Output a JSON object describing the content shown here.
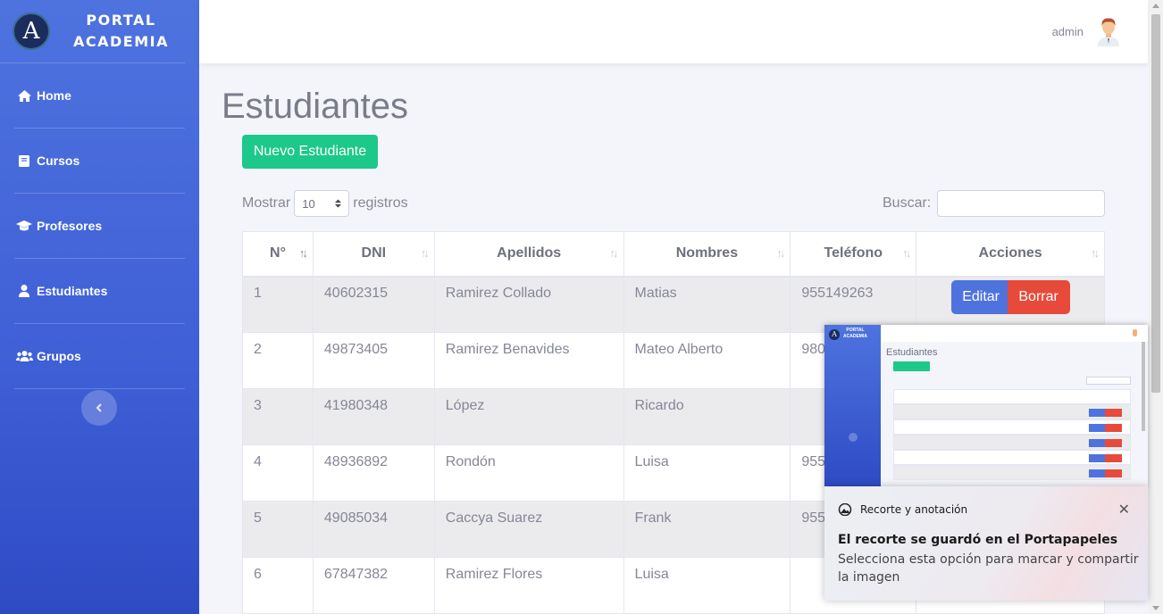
{
  "brand": {
    "logo_letter": "A",
    "line1": "PORTAL",
    "line2": "ACADEMIA"
  },
  "sidebar": {
    "items": [
      {
        "label": "Home",
        "icon": "home-icon"
      },
      {
        "label": "Cursos",
        "icon": "book-icon"
      },
      {
        "label": "Profesores",
        "icon": "graduation-cap-icon"
      },
      {
        "label": "Estudiantes",
        "icon": "user-icon"
      },
      {
        "label": "Grupos",
        "icon": "users-icon"
      }
    ],
    "toggle_icon": "chevron-left-icon"
  },
  "topbar": {
    "user_name": "admin"
  },
  "page": {
    "title": "Estudiantes",
    "new_button": "Nuevo Estudiante",
    "length_prefix": "Mostrar",
    "length_value": "10",
    "length_suffix": "registros",
    "search_label": "Buscar:",
    "search_value": ""
  },
  "table": {
    "headers": [
      "N°",
      "DNI",
      "Apellidos",
      "Nombres",
      "Teléfono",
      "Acciones"
    ],
    "edit_label": "Editar",
    "delete_label": "Borrar",
    "rows": [
      {
        "n": "1",
        "dni": "40602315",
        "apellidos": "Ramirez Collado",
        "nombres": "Matias",
        "telefono": "955149263"
      },
      {
        "n": "2",
        "dni": "49873405",
        "apellidos": "Ramirez Benavides",
        "nombres": "Mateo Alberto",
        "telefono": "980"
      },
      {
        "n": "3",
        "dni": "41980348",
        "apellidos": "López",
        "nombres": "Ricardo",
        "telefono": ""
      },
      {
        "n": "4",
        "dni": "48936892",
        "apellidos": "Rondón",
        "nombres": "Luisa",
        "telefono": "955"
      },
      {
        "n": "5",
        "dni": "49085034",
        "apellidos": "Caccya Suarez",
        "nombres": "Frank",
        "telefono": "955"
      },
      {
        "n": "6",
        "dni": "67847382",
        "apellidos": "Ramirez Flores",
        "nombres": "Luisa",
        "telefono": ""
      }
    ]
  },
  "toast": {
    "app_name": "Recorte y anotación",
    "heading": "El recorte se guardó en el Portapapeles",
    "body": "Selecciona esta opción para marcar y compartir la imagen"
  },
  "colors": {
    "sidebar": "#4e73df",
    "success": "#1cc88a",
    "primary": "#4e73df",
    "danger": "#e74a3b"
  }
}
